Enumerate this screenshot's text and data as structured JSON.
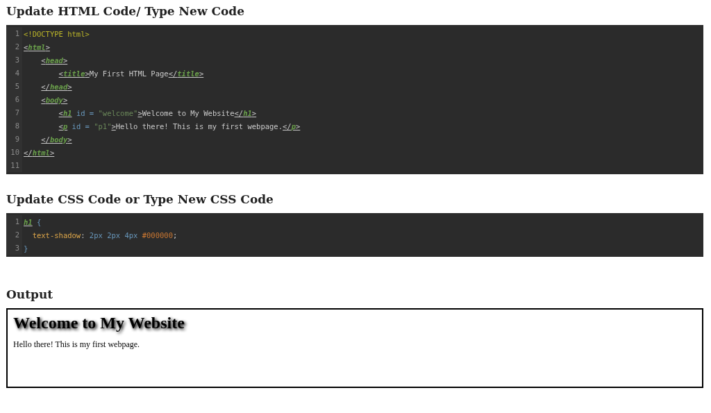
{
  "html_editor": {
    "heading": "Update HTML Code/ Type New Code",
    "lines": [
      {
        "number": "1",
        "tokens": [
          {
            "kind": "doctype",
            "text": "<!DOCTYPE html>"
          }
        ]
      },
      {
        "number": "2",
        "tokens": [
          {
            "kind": "tag",
            "text": "<html>"
          }
        ]
      },
      {
        "number": "3",
        "tokens": [
          {
            "kind": "tag",
            "text": "    <head>"
          }
        ]
      },
      {
        "number": "4",
        "tokens": [
          {
            "kind": "tag",
            "text": "        <title>"
          },
          {
            "kind": "text",
            "text": "My First HTML Page"
          },
          {
            "kind": "tag",
            "text": "</title>"
          }
        ]
      },
      {
        "number": "5",
        "tokens": [
          {
            "kind": "tag",
            "text": "    </head>"
          }
        ]
      },
      {
        "number": "6",
        "tokens": [
          {
            "kind": "tag",
            "text": "    <body>"
          }
        ]
      },
      {
        "number": "7",
        "tokens": [
          {
            "kind": "tag",
            "text": "        <h1"
          },
          {
            "kind": "attr",
            "text": " id = "
          },
          {
            "kind": "string",
            "text": "\"welcome\""
          },
          {
            "kind": "tag",
            "text": ">"
          },
          {
            "kind": "text",
            "text": "Welcome to My Website"
          },
          {
            "kind": "tag",
            "text": "</h1>"
          }
        ]
      },
      {
        "number": "8",
        "tokens": [
          {
            "kind": "tag",
            "text": "        <p"
          },
          {
            "kind": "attr",
            "text": " id = "
          },
          {
            "kind": "string",
            "text": "\"p1\""
          },
          {
            "kind": "tag",
            "text": ">"
          },
          {
            "kind": "text",
            "text": "Hello there! This is my first webpage."
          },
          {
            "kind": "tag",
            "text": "</p>"
          }
        ]
      },
      {
        "number": "9",
        "tokens": [
          {
            "kind": "tag",
            "text": "    </body>"
          }
        ]
      },
      {
        "number": "10",
        "tokens": [
          {
            "kind": "tag",
            "text": "</html>"
          }
        ]
      },
      {
        "number": "11"
      }
    ]
  },
  "css_editor": {
    "heading": "Update CSS Code or Type New CSS Code",
    "lines": [
      {
        "number": "1",
        "tokens": [
          {
            "kind": "selector",
            "text": "h1"
          },
          {
            "kind": "punct",
            "text": " {"
          }
        ]
      },
      {
        "number": "2",
        "tokens": [
          {
            "kind": "property",
            "text": "  text-shadow"
          },
          {
            "kind": "text",
            "text": ": "
          },
          {
            "kind": "number",
            "text": "2px 2px 4px "
          },
          {
            "kind": "color",
            "text": "#000000"
          },
          {
            "kind": "text",
            "text": ";"
          }
        ]
      },
      {
        "number": "3",
        "tokens": [
          {
            "kind": "punct",
            "text": "}"
          }
        ]
      }
    ]
  },
  "output": {
    "heading": "Output",
    "title": "Welcome to My Website",
    "paragraph": "Hello there! This is my first webpage."
  }
}
